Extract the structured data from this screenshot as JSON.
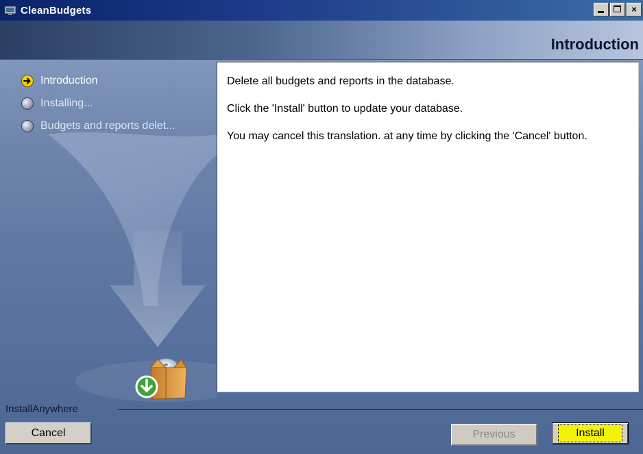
{
  "window": {
    "title": "CleanBudgets",
    "controls": {
      "minimize_icon": "minimize-icon",
      "maximize_icon": "maximize-icon",
      "close_icon": "close-icon",
      "close_glyph": "×"
    }
  },
  "header": {
    "title": "Introduction"
  },
  "steps": [
    {
      "label": "Introduction",
      "state": "current",
      "icon": "arrow-right-circle-icon"
    },
    {
      "label": "Installing...",
      "state": "pending",
      "icon": "circle-icon"
    },
    {
      "label": "Budgets and reports delet...",
      "state": "pending",
      "icon": "circle-icon"
    }
  ],
  "content": {
    "paragraphs": [
      "Delete all budgets and reports in the database.",
      "Click the 'Install' button to update your database.",
      "You may cancel this translation. at any time by clicking the 'Cancel' button."
    ]
  },
  "brand": {
    "label": "InstallAnywhere"
  },
  "footer": {
    "cancel_label": "Cancel",
    "previous_label": "Previous",
    "install_label": "Install"
  },
  "colors": {
    "titlebar": "#0a246a",
    "step_current": "#f7d000",
    "install_highlight": "#f2f20a"
  }
}
